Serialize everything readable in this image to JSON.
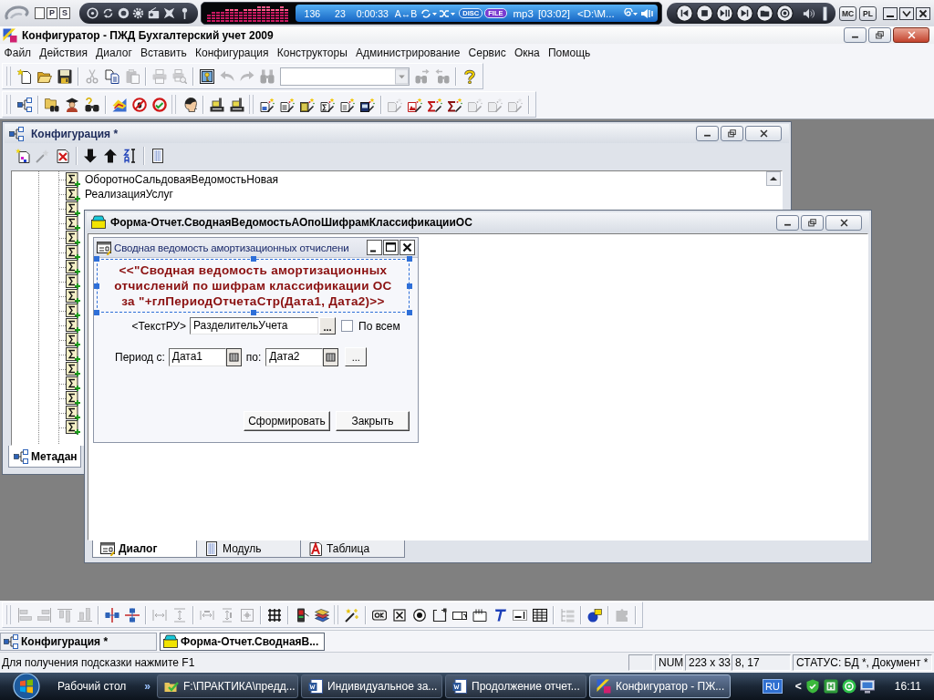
{
  "player": {
    "mode_buttons": [
      "P",
      "S"
    ],
    "display": {
      "readout_1": "136",
      "readout_2": "23",
      "time": "0:00:33",
      "ab_repeat": "A↔B",
      "disc": "DISC",
      "file": "FILE",
      "format": "mp3",
      "duration": "[03:02]",
      "path": "<D:\\M..."
    },
    "panel_buttons": [
      "MC",
      "PL"
    ]
  },
  "window": {
    "title": "Конфигуратор - ПЖД Бухгалтерский учет 2009"
  },
  "menu": [
    "Файл",
    "Действия",
    "Диалог",
    "Вставить",
    "Конфигурация",
    "Конструкторы",
    "Администрирование",
    "Сервис",
    "Окна",
    "Помощь"
  ],
  "toolbars": {
    "standard": [
      {
        "disabled": false
      },
      {
        "disabled": false
      },
      {
        "disabled": false
      },
      {
        "disabled": true
      },
      {
        "disabled": false
      },
      {
        "disabled": true
      },
      {
        "disabled": true
      },
      {
        "disabled": true
      },
      {
        "disabled": false
      },
      {
        "disabled": true
      },
      {
        "disabled": true
      },
      {
        "disabled": true
      },
      {
        "disabled": true
      },
      {
        "disabled": true
      },
      {
        "disabled": false
      }
    ],
    "tools": [
      {
        "disabled": false
      },
      {
        "disabled": false
      },
      {
        "disabled": false
      },
      {
        "disabled": false
      },
      {
        "disabled": false
      },
      {
        "disabled": false
      },
      {
        "disabled": false
      },
      {
        "disabled": false
      },
      {
        "disabled": false
      },
      {
        "disabled": false
      },
      {
        "disabled": false
      },
      {
        "disabled": false
      },
      {
        "disabled": false
      },
      {
        "disabled": false
      },
      {
        "disabled": false
      },
      {
        "disabled": false
      },
      {
        "disabled": true
      },
      {
        "disabled": false
      },
      {
        "disabled": false
      },
      {
        "disabled": false
      },
      {
        "disabled": true
      },
      {
        "disabled": true
      },
      {
        "disabled": true
      }
    ]
  },
  "config_window": {
    "title": "Конфигурация *",
    "toolbar": [
      {
        "disabled": false
      },
      {
        "disabled": true
      },
      {
        "disabled": false
      },
      {
        "disabled": false
      },
      {
        "disabled": false
      },
      {
        "disabled": false
      },
      {
        "disabled": false
      }
    ],
    "tree": [
      {
        "kind": "report",
        "label": "ОборотноСальдоваяВедомостьНовая"
      },
      {
        "kind": "report",
        "label": "РеализацияУслуг"
      },
      {
        "kind": "report"
      },
      {
        "kind": "report"
      },
      {
        "kind": "report"
      },
      {
        "kind": "report"
      },
      {
        "kind": "report"
      },
      {
        "kind": "report"
      },
      {
        "kind": "report"
      },
      {
        "kind": "report"
      },
      {
        "kind": "report"
      },
      {
        "kind": "report"
      },
      {
        "kind": "report"
      },
      {
        "kind": "report"
      },
      {
        "kind": "report"
      },
      {
        "kind": "report"
      },
      {
        "kind": "report"
      },
      {
        "kind": "report"
      }
    ],
    "tabs": [
      {
        "label": "Метадан",
        "selected": true
      }
    ]
  },
  "form_window": {
    "title": "Форма-Отчет.СводнаяВедомостьАОпоШифрамКлассификацииОС",
    "dialog": {
      "title": "Сводная ведомость амортизационных отчислени",
      "caption": "<<\"Сводная ведомость амортизационных\nотчислений по шифрам классификации ОС\nза \"+глПериодОтчетаСтр(Дата1, Дата2)>>",
      "text_field": {
        "label": "<ТекстРУ>",
        "value": "РазделительУчета",
        "button": "..."
      },
      "all_checkbox": {
        "label": "По всем",
        "checked": false
      },
      "period": {
        "from_label": "Период с:",
        "from_value": "Дата1",
        "to_label": "по:",
        "to_value": "Дата2",
        "button": "..."
      },
      "buttons": [
        "Сформировать",
        "Закрыть"
      ]
    },
    "tabs": [
      {
        "kind": "dialog",
        "label": "Диалог",
        "selected": true
      },
      {
        "kind": "module",
        "label": "Модуль",
        "selected": false
      },
      {
        "kind": "table",
        "label": "Таблица",
        "selected": false
      }
    ]
  },
  "dialog_toolbar": [
    {
      "disabled": true
    },
    {
      "disabled": true
    },
    {
      "disabled": true
    },
    {
      "disabled": true
    },
    {
      "disabled": false
    },
    {
      "disabled": false
    },
    {
      "disabled": true
    },
    {
      "disabled": true
    },
    {
      "disabled": true
    },
    {
      "disabled": true
    },
    {
      "disabled": true
    },
    {
      "disabled": false
    },
    {
      "disabled": false
    },
    {
      "disabled": false
    },
    {
      "disabled": false
    },
    {
      "disabled": false
    },
    {
      "disabled": false
    },
    {
      "disabled": false
    },
    {
      "disabled": false
    },
    {
      "disabled": false
    },
    {
      "disabled": false
    },
    {
      "disabled": false
    },
    {
      "disabled": false
    },
    {
      "disabled": false
    },
    {
      "disabled": true
    },
    {
      "disabled": false
    },
    {
      "disabled": true
    }
  ],
  "window_tabs": [
    {
      "kind": "configuration",
      "label": "Конфигурация *",
      "selected": false
    },
    {
      "kind": "form",
      "label": "Форма-Отчет.СводнаяВ...",
      "selected": true
    }
  ],
  "status_bar": {
    "hint": "Для получения подсказки нажмите F1",
    "num": "NUM",
    "size": "223 x 33",
    "position": "8, 17",
    "status": "СТАТУС: БД *, Документ *"
  },
  "taskbar": {
    "desktop": "Рабочий стол",
    "overflow": "»",
    "tasks": [
      {
        "kind": "folder",
        "label": "F:\\ПРАКТИКА\\предд...",
        "selected": false
      },
      {
        "kind": "document",
        "label": "Индивидуальное за...",
        "selected": false
      },
      {
        "kind": "document",
        "label": "Продолжение отчет...",
        "selected": false
      },
      {
        "kind": "application",
        "label": "Конфигуратор - ПЖ...",
        "selected": true
      }
    ],
    "language": "RU",
    "tray_expand": "<",
    "clock": "16:11"
  }
}
